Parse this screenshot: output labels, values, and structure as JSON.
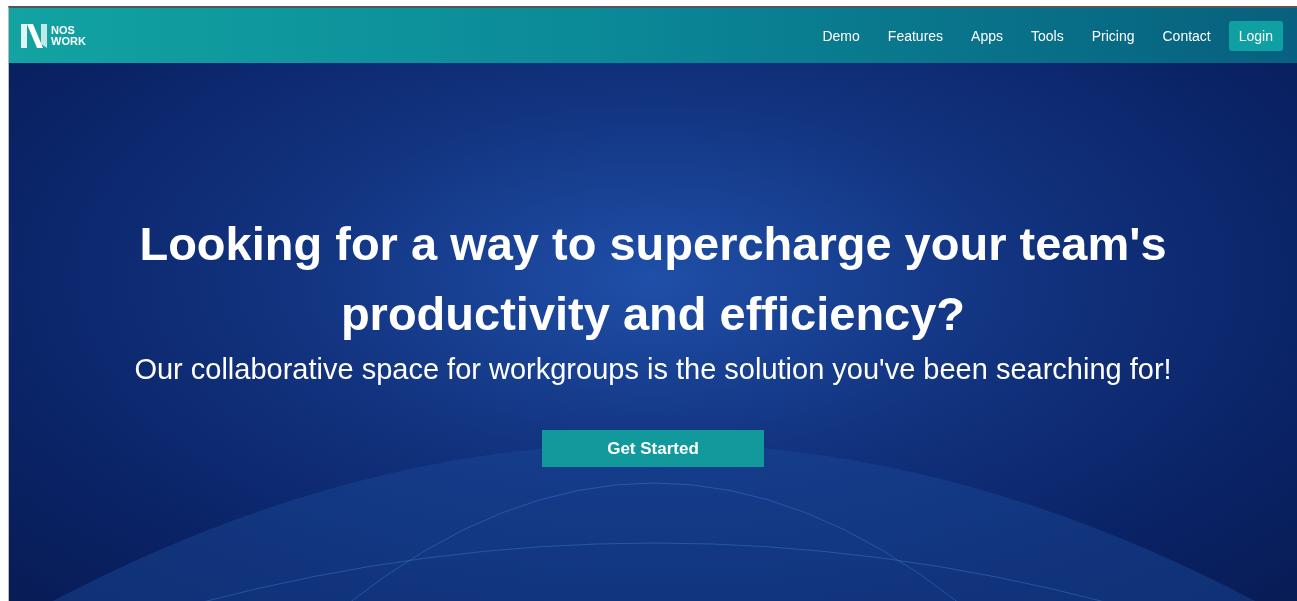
{
  "logo": {
    "line_1": "NOS",
    "line_2": "WORK"
  },
  "nav": [
    {
      "label": "Demo",
      "kind": "link"
    },
    {
      "label": "Features",
      "kind": "link"
    },
    {
      "label": "Apps",
      "kind": "link"
    },
    {
      "label": "Tools",
      "kind": "link"
    },
    {
      "label": "Pricing",
      "kind": "link"
    },
    {
      "label": "Contact",
      "kind": "link"
    },
    {
      "label": "Login",
      "kind": "button"
    }
  ],
  "hero": {
    "title": "Looking for a way to supercharge your team's productivity and efficiency?",
    "subtitle": "Our collaborative space for workgroups is the solution you've been searching for!",
    "button": "Get Started"
  }
}
